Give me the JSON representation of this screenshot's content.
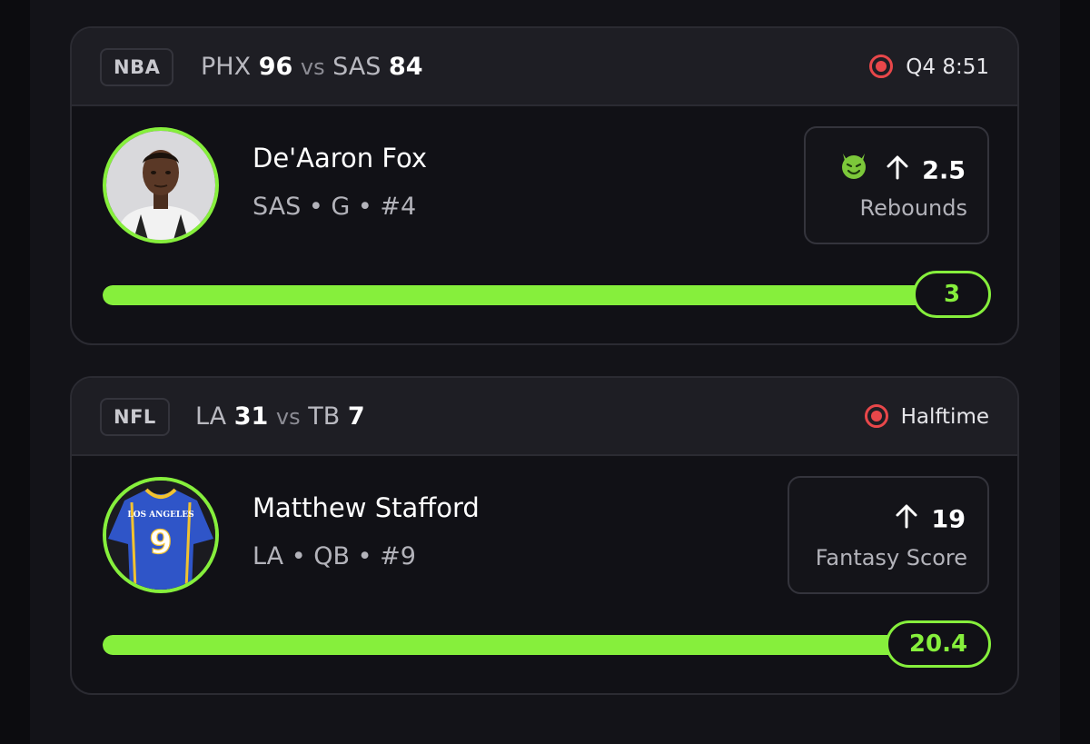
{
  "cards": [
    {
      "league": "NBA",
      "team_a": "PHX",
      "score_a": "96",
      "vs": "vs",
      "team_b": "SAS",
      "score_b": "84",
      "status": "Q4 8:51",
      "player_name": "De'Aaron Fox",
      "player_meta": "SAS • G • #4",
      "prop_value": "2.5",
      "prop_direction": "up",
      "prop_stat": "Rebounds",
      "prop_icon": "demon-icon",
      "progress_value": "3",
      "progress_fraction": 1.0
    },
    {
      "league": "NFL",
      "team_a": "LA",
      "score_a": "31",
      "vs": "vs",
      "team_b": "TB",
      "score_b": "7",
      "status": "Halftime",
      "player_name": "Matthew Stafford",
      "player_meta": "LA • QB • #9",
      "prop_value": "19",
      "prop_direction": "up",
      "prop_stat": "Fantasy Score",
      "progress_value": "20.4",
      "progress_fraction": 1.0,
      "jersey_text": "LOS ANGELES",
      "jersey_number": "9"
    }
  ],
  "colors": {
    "accent": "#86ef3c",
    "live": "#e8474a",
    "jersey": "#2f55c8",
    "jersey_trim": "#f2c230"
  }
}
